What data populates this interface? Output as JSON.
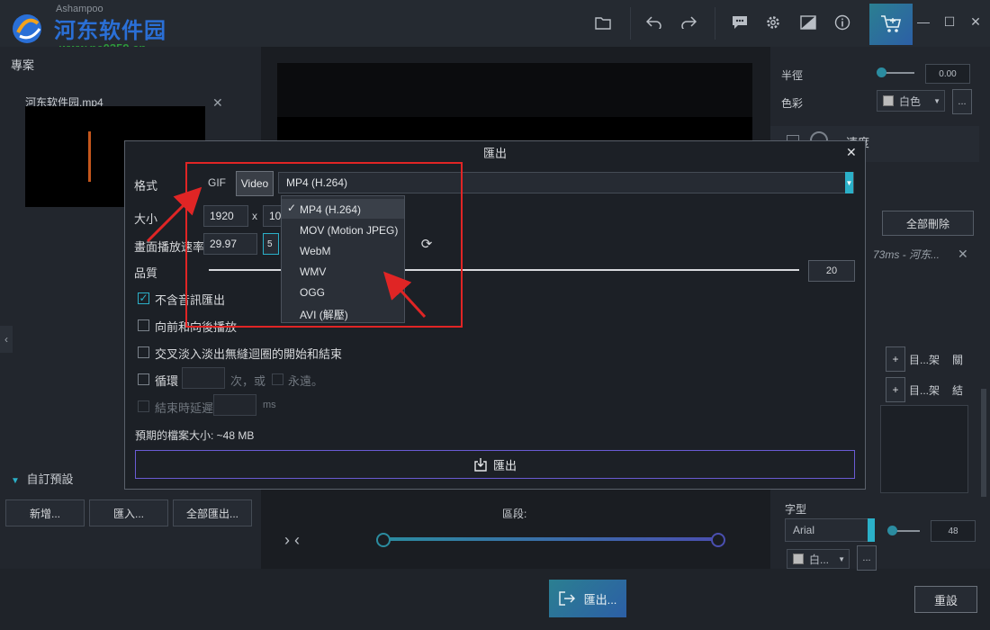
{
  "header": {
    "brand_small": "Ashampoo",
    "brand_big": "河东软件园",
    "brand_url": "www.pc0359.cn",
    "icons": [
      "folder-icon",
      "undo-icon",
      "redo-icon",
      "feedback-icon",
      "gear-icon",
      "theme-icon",
      "info-icon",
      "cart-icon",
      "minimize-icon",
      "maximize-icon",
      "close-icon"
    ]
  },
  "left": {
    "project_label": "專案",
    "clip_name": "河东软件园.mp4",
    "custom_preset_label": "自訂預設",
    "buttons": {
      "new": "新增...",
      "import": "匯入...",
      "export_all": "全部匯出..."
    }
  },
  "center": {
    "segment_label": "區段:",
    "nav_arrows": "› ‹"
  },
  "bottom": {
    "export_label": "匯出...",
    "reset_label": "重設"
  },
  "right": {
    "radius_label": "半徑",
    "radius_value": "0.00",
    "color_label": "色彩",
    "color_value": "白色",
    "speed_label": "速度",
    "delete_all": "全部刪除",
    "clip_info": "73ms - 河东...",
    "link1": "目...架",
    "link1_extra": "關",
    "link2": "目...架",
    "link2_extra": "結",
    "font_label": "字型",
    "font_value": "Arial",
    "font_size": "48",
    "font_color": "白..."
  },
  "modal": {
    "title": "匯出",
    "format_label": "格式",
    "gif_label": "GIF",
    "video_label": "Video",
    "codec_value": "MP4 (H.264)",
    "size_label": "大小",
    "width_value": "1920",
    "x_sep": "x",
    "height_value": "10",
    "framerate_label": "畫面播放速率",
    "framerate_value": "29.97",
    "framerate_extra": "5",
    "quality_label": "品質",
    "quality_value": "20",
    "opt_no_audio": "不含音訊匯出",
    "opt_forward_back": "向前和向後播放",
    "opt_crossfade": "交叉淡入淡出無縫迴圈的開始和結束",
    "opt_loop": "循環",
    "opt_loop_times": "次，或",
    "opt_forever": "永遠。",
    "opt_end_delay": "結束時延遲",
    "opt_ms": "ms",
    "est_size": "預期的檔案大小: ~48 MB",
    "export_button": "匯出",
    "codec_options": [
      "MP4 (H.264)",
      "MOV (Motion JPEG)",
      "WebM",
      "WMV",
      "OGG",
      "AVI (解壓)"
    ],
    "selected_mark": "✓"
  },
  "colors": {
    "accent": "#2bb0c8",
    "annotation": "#e02525",
    "export_border": "#6a5bd4"
  }
}
